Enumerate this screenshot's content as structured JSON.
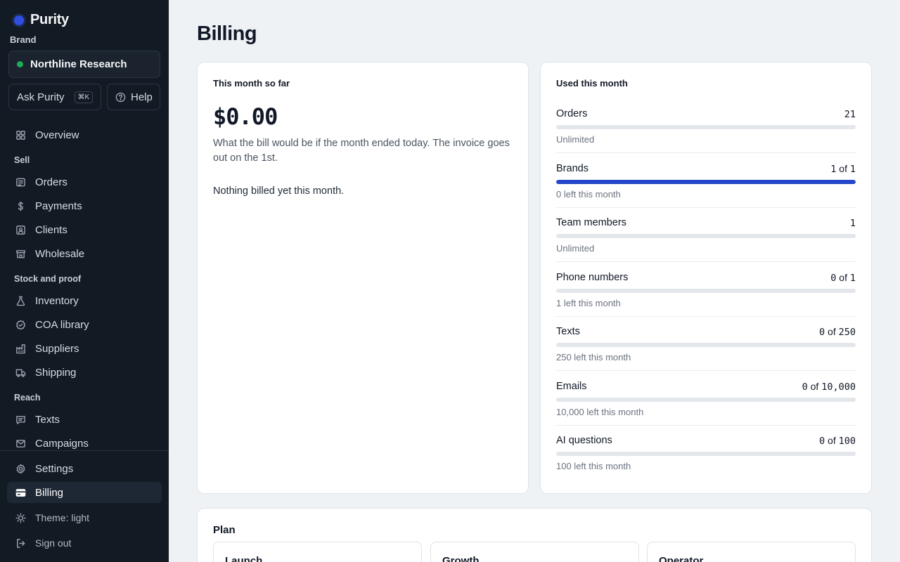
{
  "app": {
    "name": "Purity"
  },
  "sidebar": {
    "brand_label": "Brand",
    "brand_name": "Northline Research",
    "ask_label": "Ask Purity",
    "ask_shortcut": "⌘K",
    "help_label": "Help",
    "overview": "Overview",
    "sections": {
      "sell": "Sell",
      "stock": "Stock and proof",
      "reach": "Reach"
    },
    "items": {
      "orders": "Orders",
      "payments": "Payments",
      "clients": "Clients",
      "wholesale": "Wholesale",
      "inventory": "Inventory",
      "coa": "COA library",
      "suppliers": "Suppliers",
      "shipping": "Shipping",
      "texts": "Texts",
      "campaigns": "Campaigns",
      "settings": "Settings",
      "billing": "Billing"
    },
    "theme": "Theme: light",
    "signout": "Sign out"
  },
  "page": {
    "title": "Billing"
  },
  "month_card": {
    "heading": "This month so far",
    "amount": "$0.00",
    "description": "What the bill would be if the month ended today. The invoice goes out on the 1st.",
    "empty": "Nothing billed yet this month."
  },
  "usage_card": {
    "heading": "Used this month",
    "rows": [
      {
        "name": "Orders",
        "value": "21",
        "sub": "Unlimited",
        "fill": 0
      },
      {
        "name": "Brands",
        "used": "1",
        "of": "of",
        "limit": "1",
        "sub": "0 left this month",
        "fill": 1
      },
      {
        "name": "Team members",
        "value": "1",
        "sub": "Unlimited",
        "fill": 0
      },
      {
        "name": "Phone numbers",
        "used": "0",
        "of": "of",
        "limit": "1",
        "sub": "1 left this month",
        "fill": 0
      },
      {
        "name": "Texts",
        "used": "0",
        "of": "of",
        "limit": "250",
        "sub": "250 left this month",
        "fill": 0
      },
      {
        "name": "Emails",
        "used": "0",
        "of": "of",
        "limit": "10,000",
        "sub": "10,000 left this month",
        "fill": 0
      },
      {
        "name": "AI questions",
        "used": "0",
        "of": "of",
        "limit": "100",
        "sub": "100 left this month",
        "fill": 0
      }
    ]
  },
  "plan_card": {
    "heading": "Plan",
    "plans": [
      "Launch",
      "Growth",
      "Operator"
    ]
  },
  "colors": {
    "accent": "#2447c9",
    "sidebar_bg": "#121a24",
    "status_green": "#1faa59"
  }
}
